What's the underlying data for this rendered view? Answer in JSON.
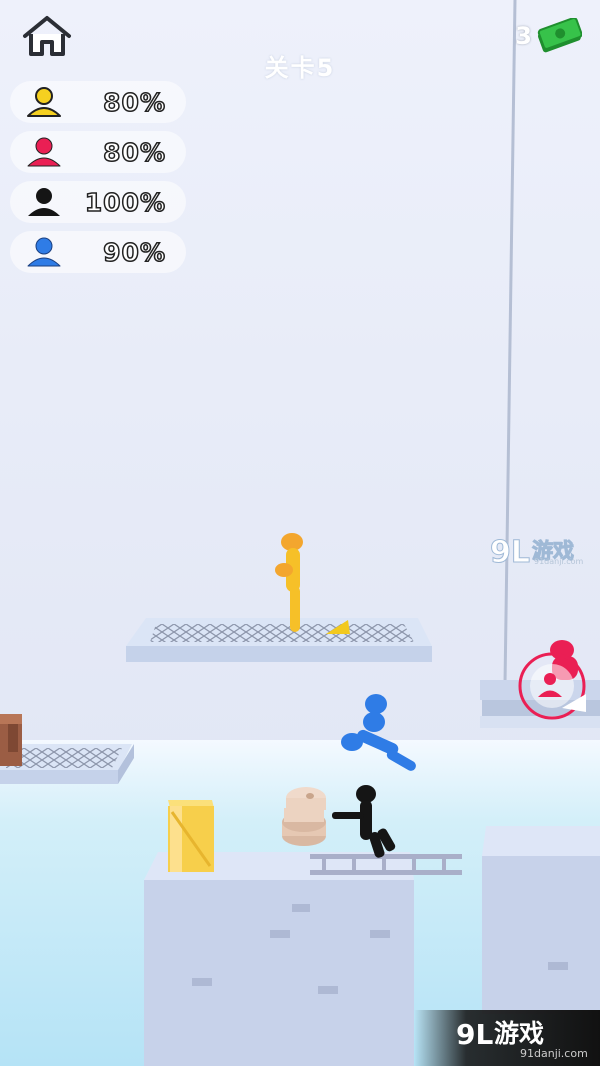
{
  "hud": {
    "level_title": "关卡5",
    "cash_count": "3"
  },
  "players": [
    {
      "color": "#f5d020",
      "percent": "80%"
    },
    {
      "color": "#ea1f54",
      "percent": "80%"
    },
    {
      "color": "#151515",
      "percent": "100%"
    },
    {
      "color": "#2f7ce6",
      "percent": "90%"
    }
  ],
  "watermark": {
    "top_text": "游戏",
    "top_sub": "91danji.com",
    "bottom_text": "游戏",
    "bottom_sub": "91danji.com"
  },
  "colors": {
    "sky_top": "#eef1fb",
    "sky_bottom": "#e4e8f6",
    "water": "#bde8f8",
    "platform": "#cfdcf3",
    "tower": "#c9d4ec"
  }
}
